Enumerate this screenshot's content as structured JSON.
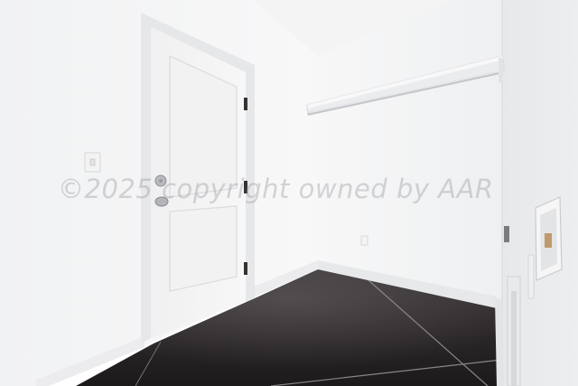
{
  "photo": {
    "subject": "empty laundry room with white door, closet shelf and rod, dark polished concrete floor",
    "watermark_text": "©2025 copyright owned by AAR",
    "colors": {
      "wall": "#f6f6f7",
      "wall_shadow": "#e9eaec",
      "floor": "#2a2628",
      "door": "#f3f3f4",
      "trim": "#ececee"
    }
  }
}
